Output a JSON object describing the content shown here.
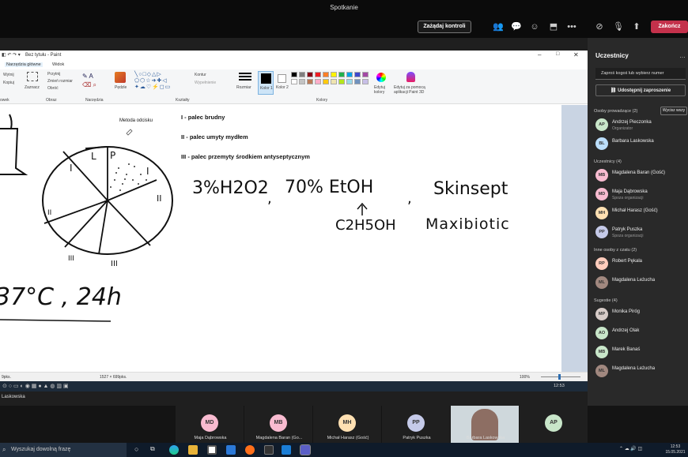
{
  "teams": {
    "title": "Spotkanie",
    "control_button": "Zażądaj kontroli",
    "end_button": "Zakończ"
  },
  "paint": {
    "window_title": "Bez tytułu - Paint",
    "tabs": [
      "Narzędzia główne",
      "Widok"
    ],
    "ribbon": {
      "clipboard": [
        "Wytnij",
        "Kopiuj"
      ],
      "image_group": [
        "Zaznacz",
        "Przytnij",
        "Zmień rozmiar",
        "Obróć"
      ],
      "tools_label": "Narzędzia",
      "brushes_label": "Pędzle",
      "shapes_label": "Kształty",
      "outline": "Kontur",
      "fill": "Wypełnienie",
      "size_label": "Rozmiar",
      "color1": "Kolor 1",
      "color2": "Kolor 2",
      "colors_label": "Kolory",
      "edit_colors": "Edytuj kolory",
      "paint3d": "Edytuj za pomocą aplikacji Paint 3D",
      "group_image": "Obraz",
      "group_left": "owek"
    },
    "palette": [
      "#000000",
      "#7f7f7f",
      "#880015",
      "#ed1c24",
      "#ff7f27",
      "#fff200",
      "#22b14c",
      "#00a2e8",
      "#3f48cc",
      "#a349a4",
      "#ffffff",
      "#c3c3c3",
      "#b97a57",
      "#ffaec9",
      "#ffc90e",
      "#efe4b0",
      "#b5e61d",
      "#99d9ea",
      "#7092be",
      "#c8bfe7"
    ],
    "canvas": {
      "method_label": "Metoda odcisku",
      "lines": [
        "I - palec brudny",
        "II - palec umyty mydłem",
        "III - palec przemyty środkiem antyseptycznym"
      ],
      "handwriting": {
        "h2o2": "3%H2O2",
        "etoh": "70% EtOH",
        "c2h5oh": "C2H5OH",
        "skinsept": "Skinsept",
        "maxibiotic": "Maxibiotic",
        "incubation": "37°C , 24h",
        "pie_labels": [
          "I",
          "L",
          "P",
          "I",
          "II",
          "II",
          "III",
          "III"
        ]
      }
    },
    "status": {
      "left": "9pks.",
      "dims": "1527 × 699pks.",
      "zoom": "100%"
    },
    "inner_clock": "12:53"
  },
  "presenter_strip": "Laskowska",
  "participants_panel": {
    "title": "Uczestnicy",
    "invite_placeholder": "Zaproś kogoś lub wybierz numer",
    "share_invite": "Udostępnij zaproszenie",
    "mute_all": "Wycisz wszy",
    "sections": [
      {
        "header": "Osoby prowadzące (2)",
        "people": [
          {
            "initials": "AP",
            "name": "Andrzej Pieczonka",
            "role": "Organizator",
            "color": "#c8e6c9"
          },
          {
            "initials": "BL",
            "name": "Barbara Laskowska",
            "role": "",
            "color": "#bbdefb"
          }
        ]
      },
      {
        "header": "Uczestnicy (4)",
        "people": [
          {
            "initials": "MB",
            "name": "Magdalena Baran (Gość)",
            "role": "",
            "color": "#f8bbd0"
          },
          {
            "initials": "MD",
            "name": "Maja Dąbrowska",
            "role": "Spoza organizacji",
            "color": "#f8bbd0"
          },
          {
            "initials": "MH",
            "name": "Michał Harasz (Gość)",
            "role": "",
            "color": "#ffe0b2"
          },
          {
            "initials": "PP",
            "name": "Patryk Puszka",
            "role": "Spoza organizacji",
            "color": "#c5cae9"
          }
        ]
      },
      {
        "header": "Inne osoby z czatu (2)",
        "people": [
          {
            "initials": "RP",
            "name": "Robert Pękala",
            "role": "",
            "color": "#ffccbc"
          },
          {
            "initials": "ML",
            "name": "Magdalena Leżucha",
            "role": "",
            "color": "#a1887f"
          }
        ]
      },
      {
        "header": "Sugestie (4)",
        "people": [
          {
            "initials": "MP",
            "name": "Monika Piróg",
            "role": "",
            "color": "#d7ccc8"
          },
          {
            "initials": "AO",
            "name": "Andrzej Olak",
            "role": "",
            "color": "#c8e6c9"
          },
          {
            "initials": "MB",
            "name": "Marek Banaś",
            "role": "",
            "color": "#c8e6c9"
          },
          {
            "initials": "ML",
            "name": "Magdalena Leżucha",
            "role": "",
            "color": "#a1887f"
          }
        ]
      }
    ]
  },
  "video_tiles": [
    {
      "initials": "MD",
      "name": "Maja Dąbrowska",
      "color": "#f8bbd0"
    },
    {
      "initials": "MB",
      "name": "Magdalena Baran (Go...",
      "color": "#f8bbd0"
    },
    {
      "initials": "MH",
      "name": "Michał Harasz (Gość)",
      "color": "#ffe0b2"
    },
    {
      "initials": "PP",
      "name": "Patryk Puszka",
      "color": "#c5cae9"
    },
    {
      "initials": "",
      "name": "Barbara Laskowska",
      "color": "#8d6e63"
    },
    {
      "initials": "AP",
      "name": "",
      "color": "#c8e6c9"
    }
  ],
  "taskbar": {
    "search_placeholder": "Wyszukaj dowolną frazę",
    "time": "12:53",
    "date": "15.05.2021"
  }
}
